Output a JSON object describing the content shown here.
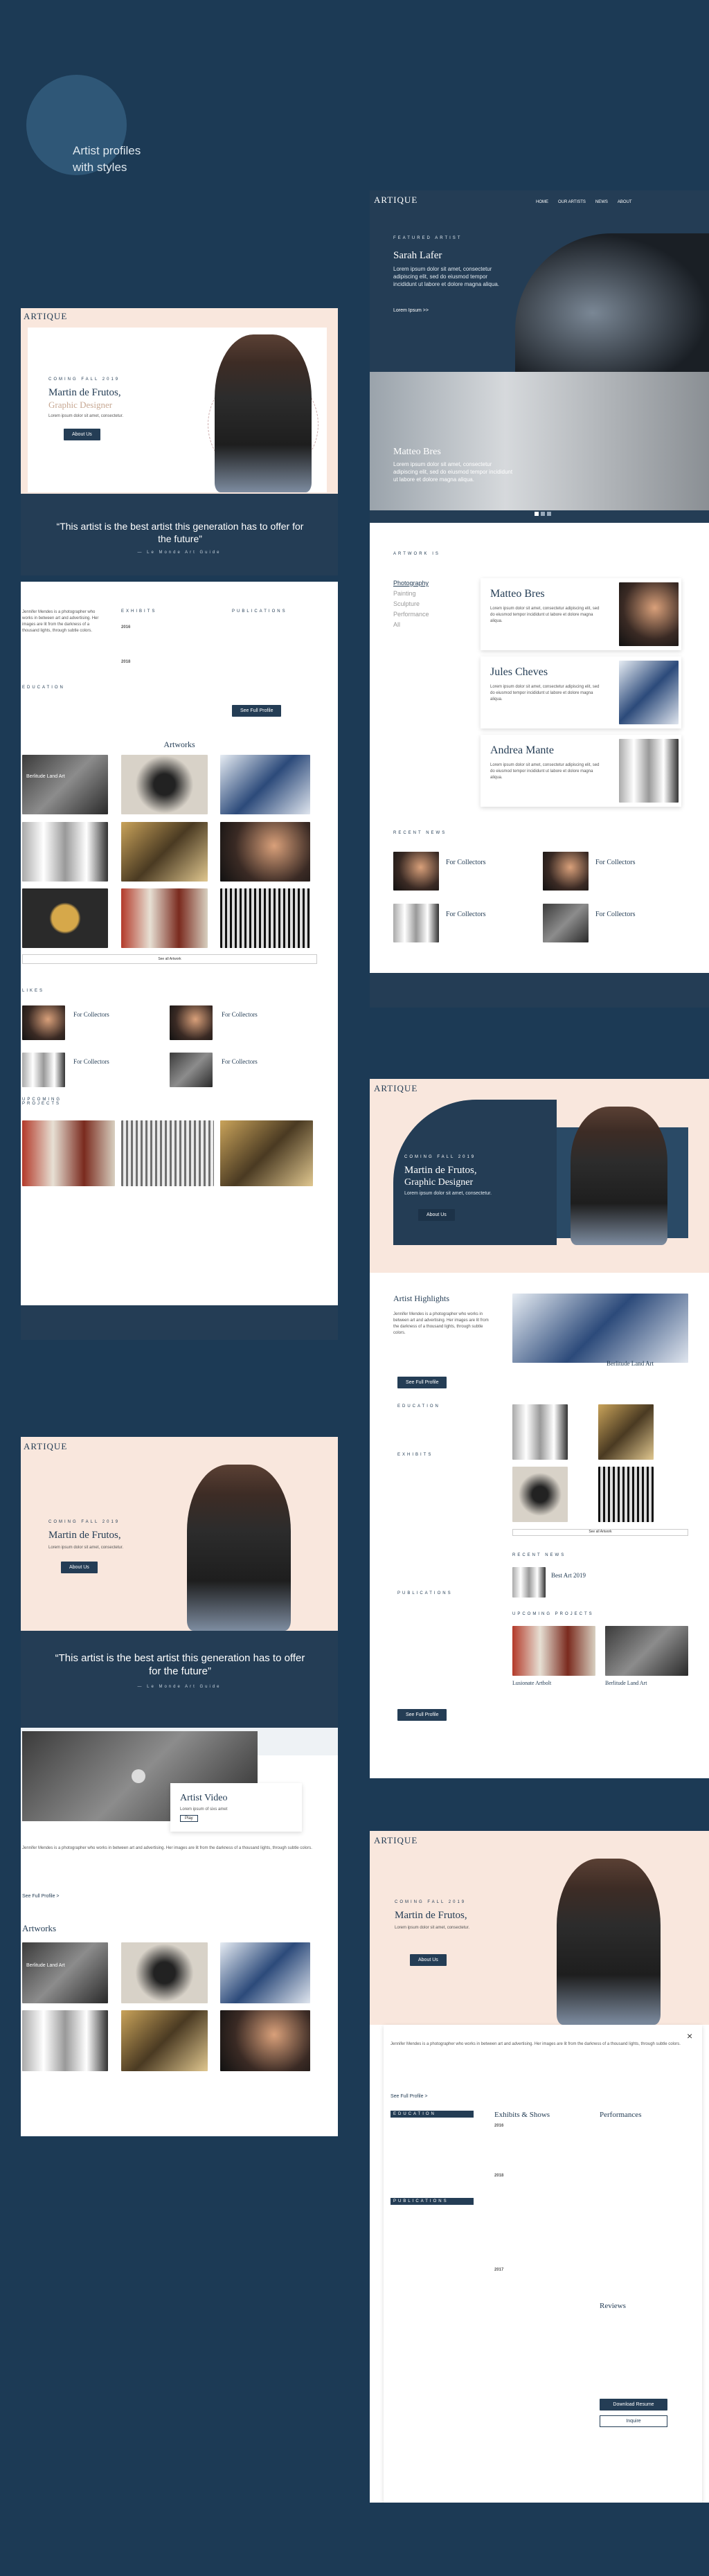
{
  "intro": {
    "line1": "Artist profiles",
    "line2": "with styles"
  },
  "brand": {
    "logo": "ARTIQUE"
  },
  "nav": [
    "HOME",
    "OUR ARTISTS",
    "NEWS",
    "ABOUT"
  ],
  "hero": {
    "kicker": "Coming Fall 2019",
    "name": "Martin de Frutos,",
    "role": "Graphic Designer",
    "tagline": "Lorem ipsum dolor sit amet, consectetur.",
    "cta": "About Us"
  },
  "quote": {
    "text": "“This artist is the best artist this generation has to offer for the future”",
    "source": "— Le Monde Art Guide"
  },
  "profile": {
    "bio": "Jennifer Mendes is a photographer who works in between art and advertising. Her images are lit from the darkness of a thousand lights, through subtle colors.",
    "sections": {
      "exhibits": "Exhibits",
      "publications": "Publications",
      "education": "Education"
    },
    "years": [
      "2016",
      "2018",
      "2017"
    ],
    "see_full": "See Full Profile"
  },
  "artworks": {
    "title": "Artworks",
    "featured": "Berlitude Land Art",
    "view_all": "See all Artwork"
  },
  "likes": {
    "title": "Likes",
    "items": [
      "For Collectors",
      "For Collectors",
      "For Collectors",
      "For Collectors"
    ]
  },
  "upcoming": {
    "title": "Upcoming Projects"
  },
  "featured": {
    "kicker": "Featured Artist",
    "name": "Sarah Lafer",
    "text": "Lorem ipsum dolor sit amet, consectetur adipiscing elit, sed do eiusmod tempor incididunt ut labore et dolore magna aliqua.",
    "more": "Lorem Ipsum >>",
    "second_name": "Matteo Bres"
  },
  "artists": {
    "title": "Artwork is",
    "categories": [
      "Photography",
      "Painting",
      "Sculpture",
      "Performance",
      "All"
    ],
    "list": [
      "Matteo Bres",
      "Jules Cheves",
      "Andrea Mante"
    ],
    "desc": "Lorem ipsum dolor sit amet, consectetur adipiscing elit, sed do eiusmod tempor incididunt ut labore et dolore magna aliqua."
  },
  "news": {
    "title": "Recent News",
    "items": [
      "For Collectors",
      "For Collectors",
      "For Collectors",
      "For Collectors"
    ]
  },
  "highlights": {
    "title": "Artist Highlights",
    "latest": "Berlitude Land Art",
    "news_title": "Best Art 2019",
    "upcoming": [
      "Lusionate Artbolt",
      "Berlitude Land Art"
    ]
  },
  "video": {
    "title": "Artist Video",
    "sub": "Lorem ipsum of sixs amet",
    "play": "Play",
    "read_full": "See Full Profile >"
  },
  "modal": {
    "exhibits": "Exhibits & Shows",
    "performances": "Performances",
    "reviews": "Reviews",
    "download": "Download Resume",
    "inquire": "Inquire",
    "close": "×"
  }
}
